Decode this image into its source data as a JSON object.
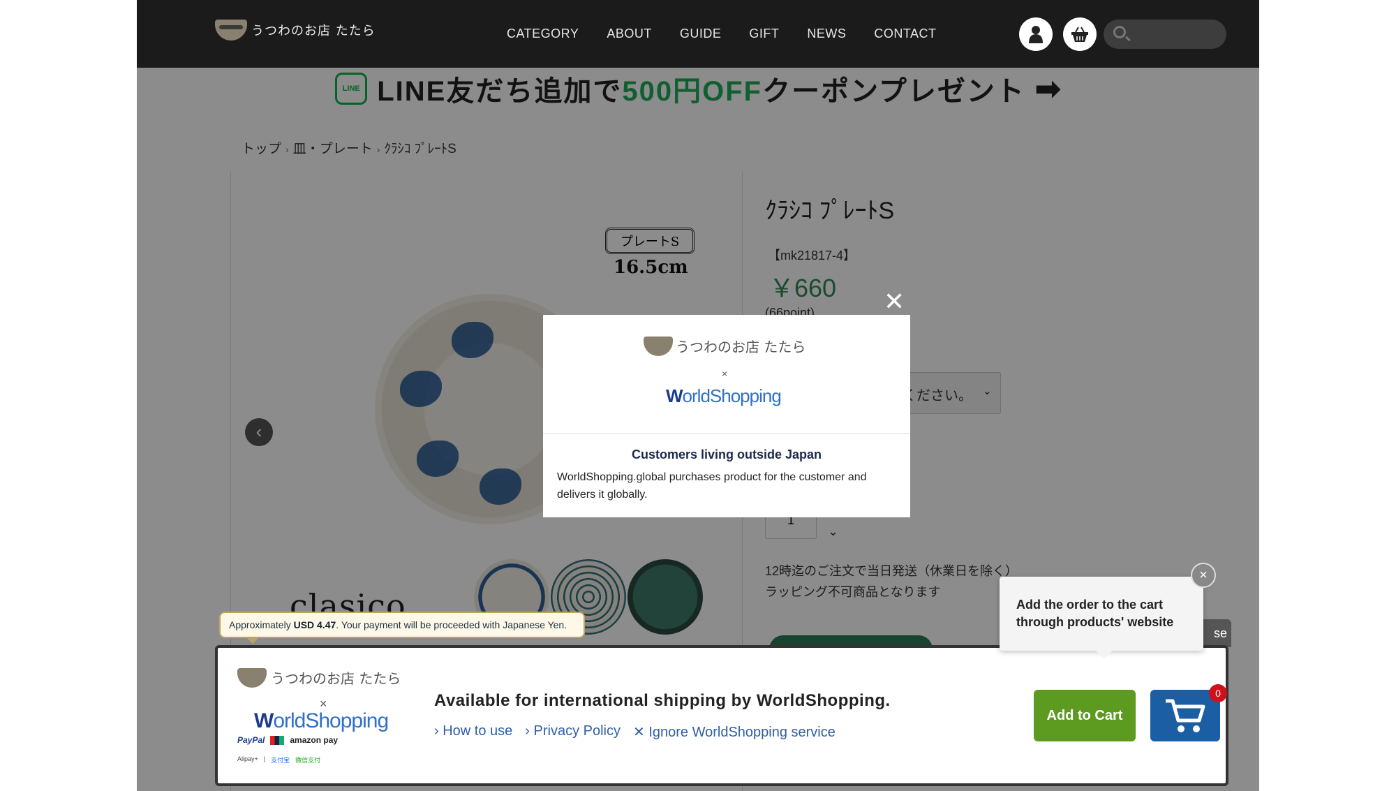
{
  "header": {
    "logo_text": "うつわのお店 たたら",
    "nav": [
      "CATEGORY",
      "ABOUT",
      "GUIDE",
      "GIFT",
      "NEWS",
      "CONTACT"
    ],
    "search_placeholder": ""
  },
  "banner": {
    "line_badge": "LINE",
    "text_part1": "LINE友だち追加で",
    "text_green": "500円OFF",
    "text_part2": "クーポンプレゼント",
    "arrow": "➡"
  },
  "breadcrumb": [
    "トップ",
    "皿・プレート",
    "ｸﾗｼｺ ﾌﾟﾚｰﾄS"
  ],
  "product_image": {
    "size_tag": "プレートS",
    "size_cm": "16.5cm",
    "brand_text": "clasico"
  },
  "product": {
    "title": "ｸﾗｼｺ ﾌﾟﾚｰﾄS",
    "code": "【mk21817-4】",
    "price": "￥660",
    "point": "(66point)",
    "select_text": "ください。",
    "quantity": "1",
    "ship_note_1": "12時迄のご注文で当日発送（休業日を除く）",
    "ship_note_2": "ラッピング不可商品となります"
  },
  "usd_tip": {
    "prefix": "Approximately ",
    "amount": "USD 4.47",
    "suffix": ". Your payment will be proceeded with Japanese Yen."
  },
  "ws_bar": {
    "shop_logo_text": "うつわのお店 たたら",
    "times": "×",
    "ws_name_w": "W",
    "ws_name_rest": "orldShopping",
    "pay_paypal": "PayPal",
    "pay_amazon": "amazon pay",
    "pay_small": [
      "Alipay+",
      "|",
      "支付宝",
      "微信支付"
    ],
    "heading": "Available for international shipping by WorldShopping.",
    "links": [
      "How to use",
      "Privacy Policy",
      "Ignore WorldShopping service"
    ],
    "add_to_cart": "Add to Cart",
    "cart_count": "0",
    "close_tab": "se"
  },
  "callout": {
    "text": "Add the order to the cart through products' website",
    "close": "×"
  },
  "modal": {
    "close": "✕",
    "logo_text": "うつわのお店 たたら",
    "times": "×",
    "ws_name_w": "W",
    "ws_name_rest": "orldShopping",
    "heading": "Customers living outside Japan",
    "body": "WorldShopping.global purchases product for the customer and delivers it globally."
  },
  "colors": {
    "header_bg": "#1b1b1b",
    "price_green": "#2e8b57",
    "add_to_cart_green": "#5d9a20",
    "cart_blue": "#1c5ea4",
    "badge_red": "#d0111b",
    "ws_blue": "#2f70c9"
  }
}
